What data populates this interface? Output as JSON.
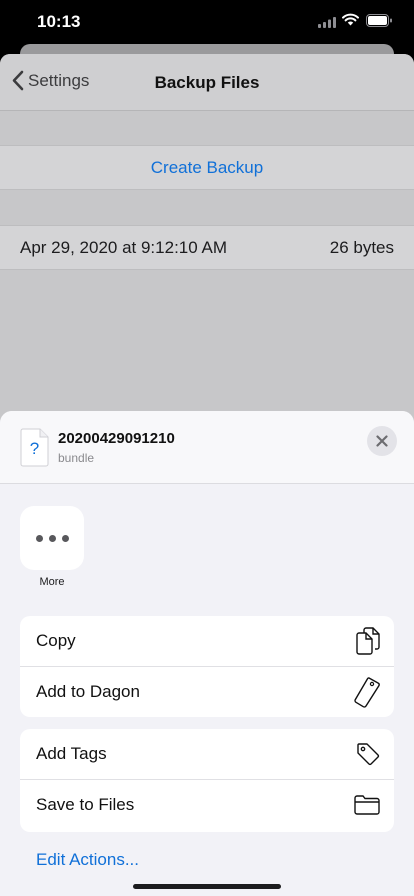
{
  "status_bar": {
    "time": "10:13"
  },
  "nav": {
    "back_label": "Settings",
    "title": "Backup Files"
  },
  "list": {
    "create_label": "Create Backup",
    "file_date": "Apr 29, 2020 at 9:12:10 AM",
    "file_size": "26 bytes"
  },
  "share_sheet": {
    "file_name": "20200429091210",
    "file_type": "bundle",
    "doc_icon_glyph": "?",
    "apps": [
      {
        "label": "More",
        "icon": "more-icon"
      }
    ],
    "group1": [
      {
        "label": "Copy",
        "icon": "copy-icon"
      },
      {
        "label": "Add to Dagon",
        "icon": "tag-icon"
      }
    ],
    "group2": [
      {
        "label": "Add Tags",
        "icon": "label-tag-icon"
      },
      {
        "label": "Save to Files",
        "icon": "folder-icon"
      }
    ],
    "edit_actions": "Edit Actions..."
  },
  "colors": {
    "accent": "#1070d8",
    "sheet_bg": "#f2f2f7"
  }
}
